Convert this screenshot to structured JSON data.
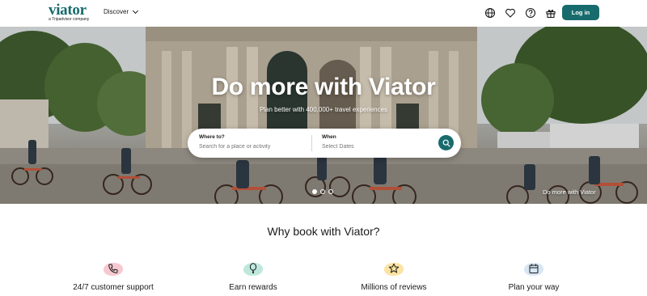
{
  "header": {
    "logo_text": "viator",
    "logo_subtext": "a Tripadvisor company",
    "discover_label": "Discover",
    "login_label": "Log in",
    "icons": [
      "globe-icon",
      "heart-icon",
      "help-icon",
      "gift-icon"
    ]
  },
  "hero": {
    "title": "Do more with Viator",
    "subtitle": "Plan better with 400,000+ travel experiences",
    "caption": "Do more with Viator",
    "carousel_active_index": 0,
    "carousel_count": 3,
    "search": {
      "where_label": "Where to?",
      "where_placeholder": "Search for a place or activity",
      "when_label": "When",
      "when_placeholder": "Select Dates"
    }
  },
  "why": {
    "title": "Why book with Viator?",
    "features": [
      {
        "label": "24/7 customer support",
        "icon": "phone-icon",
        "color": "#f6c9d0"
      },
      {
        "label": "Earn rewards",
        "icon": "balloon-icon",
        "color": "#bfe8dd"
      },
      {
        "label": "Millions of reviews",
        "icon": "star-icon",
        "color": "#fbe3a3"
      },
      {
        "label": "Plan your way",
        "icon": "calendar-icon",
        "color": "#d7e6f3"
      }
    ]
  },
  "colors": {
    "brand": "#186b6d"
  }
}
